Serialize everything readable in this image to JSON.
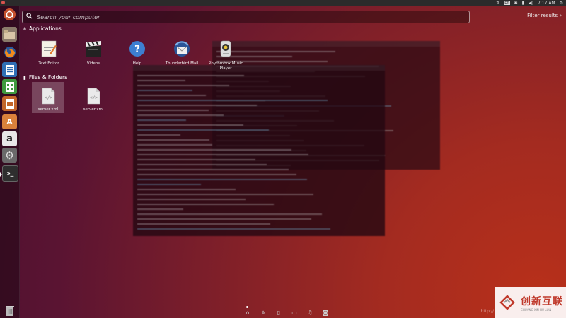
{
  "topbar": {
    "time": "7:17 AM"
  },
  "dash": {
    "search": {
      "placeholder": "Search your computer",
      "value": ""
    },
    "filter_label": "Filter results",
    "categories": [
      {
        "label": "Applications"
      },
      {
        "label": "Files & Folders"
      }
    ],
    "applications": [
      {
        "label": "Text Editor",
        "icon": "text-editor-icon"
      },
      {
        "label": "Videos",
        "icon": "clapperboard-icon"
      },
      {
        "label": "Help",
        "icon": "help-icon"
      },
      {
        "label": "Thunderbird Mail",
        "icon": "thunderbird-icon"
      },
      {
        "label": "Rhythmbox Music Player",
        "icon": "rhythmbox-icon"
      }
    ],
    "files": [
      {
        "label": "server.xml",
        "icon": "xml-file-icon",
        "selected": true
      },
      {
        "label": "server.xml",
        "icon": "xml-file-icon",
        "selected": false
      }
    ]
  },
  "launcher_items": [
    "ubuntu-dash-icon",
    "files-icon",
    "firefox-icon",
    "writer-icon",
    "calc-icon",
    "impress-icon",
    "software-center-icon",
    "amazon-icon",
    "system-settings-icon",
    "terminal-icon",
    "trash-icon"
  ],
  "watermark": {
    "brand": "创新互联",
    "sub": "CHUANG XIN HU LIAN",
    "url": "http://"
  }
}
